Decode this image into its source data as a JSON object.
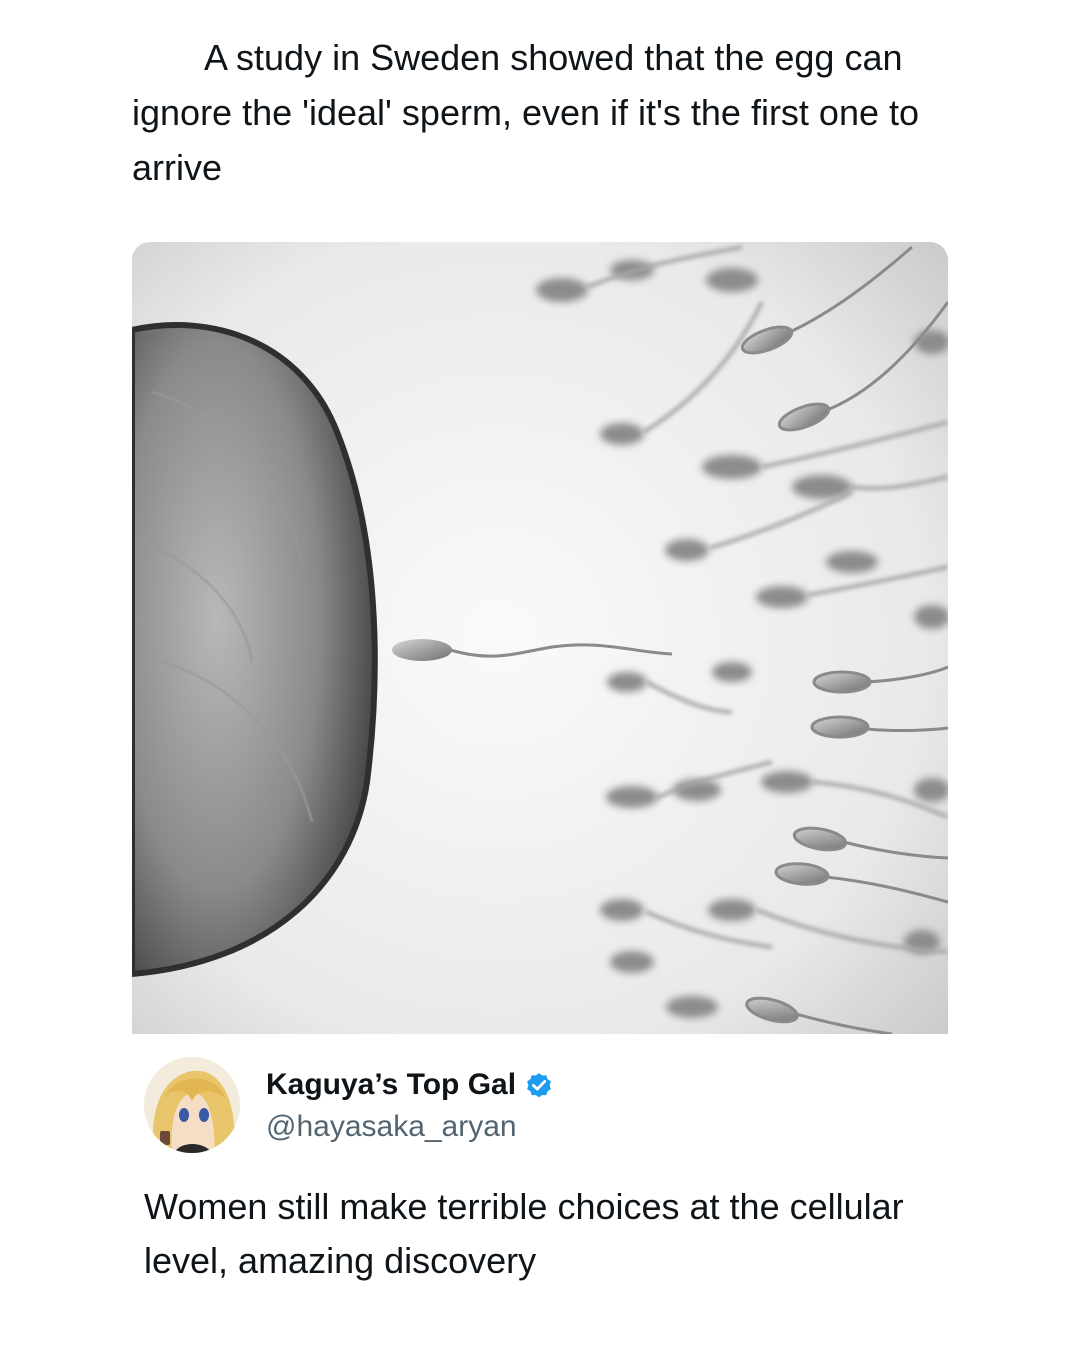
{
  "post": {
    "headline": "A study in Sweden showed that the egg can ignore the 'ideal' sperm, even if it's the first one to arrive"
  },
  "media": {
    "icon": "egg-and-sperm-photo"
  },
  "author": {
    "display_name": "Kaguya’s Top Gal",
    "handle": "@hayasaka_aryan",
    "verified_color": "#1d9bf0"
  },
  "tweet": {
    "text": "Women still make terrible choices at the cellular level, amazing discovery"
  }
}
